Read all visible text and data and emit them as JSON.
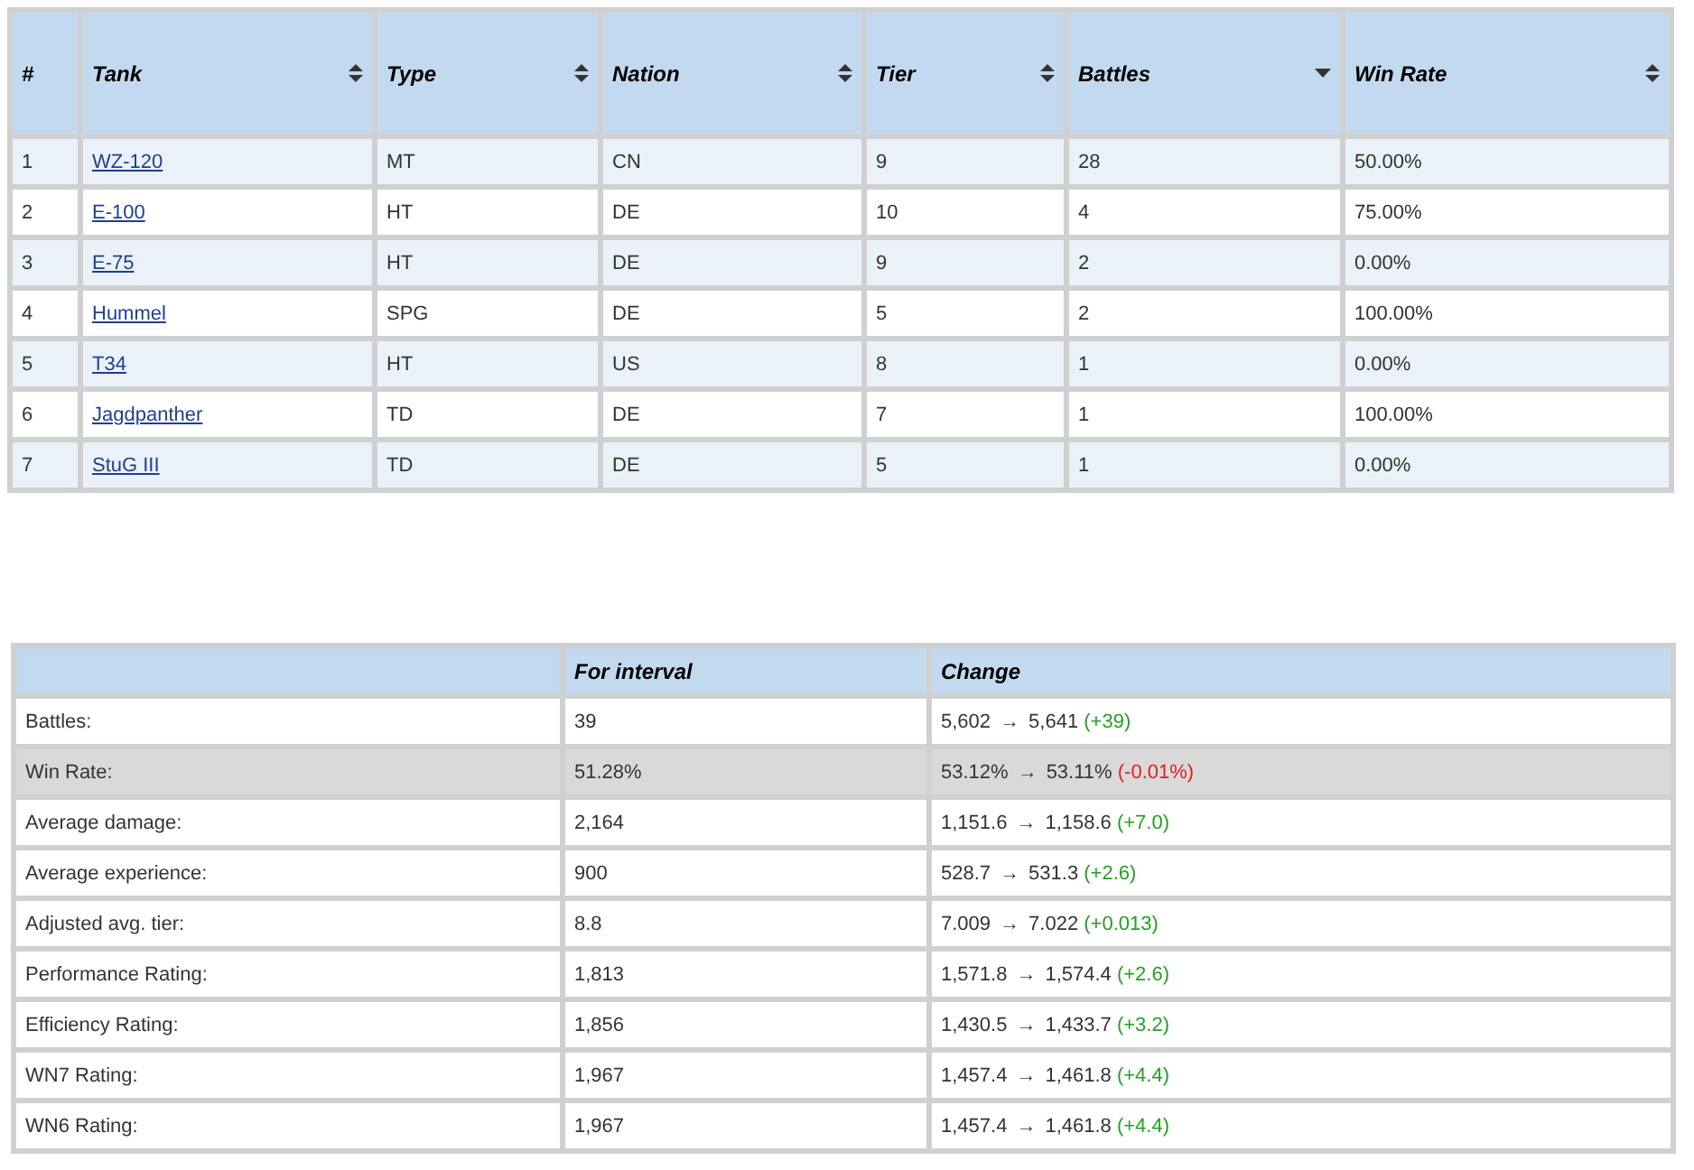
{
  "tank_table": {
    "columns": [
      {
        "label": "#",
        "sortable": false,
        "sorted_descending": false
      },
      {
        "label": "Tank",
        "sortable": true,
        "sorted_descending": false
      },
      {
        "label": "Type",
        "sortable": true,
        "sorted_descending": false
      },
      {
        "label": "Nation",
        "sortable": true,
        "sorted_descending": false
      },
      {
        "label": "Tier",
        "sortable": true,
        "sorted_descending": false
      },
      {
        "label": "Battles",
        "sortable": true,
        "sorted_descending": true
      },
      {
        "label": "Win Rate",
        "sortable": true,
        "sorted_descending": false
      }
    ],
    "rows": [
      {
        "number": "1",
        "tank": "WZ-120",
        "type": "MT",
        "nation": "CN",
        "tier": "9",
        "battles": "28",
        "win_rate": "50.00%"
      },
      {
        "number": "2",
        "tank": "E-100",
        "type": "HT",
        "nation": "DE",
        "tier": "10",
        "battles": "4",
        "win_rate": "75.00%"
      },
      {
        "number": "3",
        "tank": "E-75",
        "type": "HT",
        "nation": "DE",
        "tier": "9",
        "battles": "2",
        "win_rate": "0.00%"
      },
      {
        "number": "4",
        "tank": "Hummel",
        "type": "SPG",
        "nation": "DE",
        "tier": "5",
        "battles": "2",
        "win_rate": "100.00%"
      },
      {
        "number": "5",
        "tank": "T34",
        "type": "HT",
        "nation": "US",
        "tier": "8",
        "battles": "1",
        "win_rate": "0.00%"
      },
      {
        "number": "6",
        "tank": "Jagdpanther",
        "type": "TD",
        "nation": "DE",
        "tier": "7",
        "battles": "1",
        "win_rate": "100.00%"
      },
      {
        "number": "7",
        "tank": "StuG III",
        "type": "TD",
        "nation": "DE",
        "tier": "5",
        "battles": "1",
        "win_rate": "0.00%"
      }
    ]
  },
  "summary_table": {
    "columns": [
      "For interval",
      "Change"
    ],
    "rows": [
      {
        "label": "Battles:",
        "interval": "39",
        "from": "5,602",
        "arrow": "→",
        "to": "5,641",
        "delta": "(+39)",
        "increase": true,
        "highlighted": false
      },
      {
        "label": "Win Rate:",
        "interval": "51.28%",
        "from": "53.12%",
        "arrow": "→",
        "to": "53.11%",
        "delta": "(-0.01%)",
        "increase": false,
        "highlighted": true
      },
      {
        "label": "Average damage:",
        "interval": "2,164",
        "from": "1,151.6",
        "arrow": "→",
        "to": "1,158.6",
        "delta": "(+7.0)",
        "increase": true,
        "highlighted": false
      },
      {
        "label": "Average experience:",
        "interval": "900",
        "from": "528.7",
        "arrow": "→",
        "to": "531.3",
        "delta": "(+2.6)",
        "increase": true,
        "highlighted": false
      },
      {
        "label": "Adjusted avg. tier:",
        "interval": "8.8",
        "from": "7.009",
        "arrow": "→",
        "to": "7.022",
        "delta": "(+0.013)",
        "increase": true,
        "highlighted": false
      },
      {
        "label": "Performance Rating:",
        "interval": "1,813",
        "from": "1,571.8",
        "arrow": "→",
        "to": "1,574.4",
        "delta": "(+2.6)",
        "increase": true,
        "highlighted": false
      },
      {
        "label": "Efficiency Rating:",
        "interval": "1,856",
        "from": "1,430.5",
        "arrow": "→",
        "to": "1,433.7",
        "delta": "(+3.2)",
        "increase": true,
        "highlighted": false
      },
      {
        "label": "WN7 Rating:",
        "interval": "1,967",
        "from": "1,457.4",
        "arrow": "→",
        "to": "1,461.8",
        "delta": "(+4.4)",
        "increase": true,
        "highlighted": false
      },
      {
        "label": "WN6 Rating:",
        "interval": "1,967",
        "from": "1,457.4",
        "arrow": "→",
        "to": "1,461.8",
        "delta": "(+4.4)",
        "increase": true,
        "highlighted": false
      }
    ]
  }
}
